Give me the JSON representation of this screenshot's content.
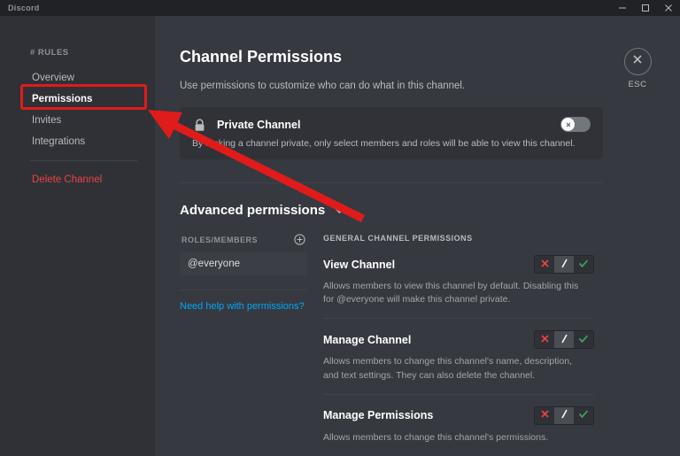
{
  "window": {
    "title": "Discord",
    "controls": [
      {
        "name": "minimize",
        "glyph": "minimize-icon"
      },
      {
        "name": "maximize",
        "glyph": "maximize-icon"
      },
      {
        "name": "close",
        "glyph": "close-icon"
      }
    ]
  },
  "sidebar": {
    "header": "# RULES",
    "items": [
      {
        "label": "Overview",
        "active": false
      },
      {
        "label": "Permissions",
        "active": true
      },
      {
        "label": "Invites",
        "active": false
      },
      {
        "label": "Integrations",
        "active": false
      }
    ],
    "danger_item": "Delete Channel"
  },
  "header": {
    "title": "Channel Permissions",
    "subtitle": "Use permissions to customize who can do what in this channel."
  },
  "esc": {
    "label": "ESC",
    "icon": "close-icon"
  },
  "private_channel": {
    "icon": "lock-icon",
    "title": "Private Channel",
    "description": "By making a channel private, only select members and roles will be able to view this channel.",
    "toggle_state": "off",
    "toggle_icon": "x-icon"
  },
  "advanced": {
    "title": "Advanced permissions",
    "chevron": "chevron-down-icon"
  },
  "roles": {
    "header": "ROLES/MEMBERS",
    "add_icon": "plus-circle-icon",
    "items": [
      {
        "label": "@everyone",
        "selected": true
      }
    ],
    "help_link": "Need help with permissions?"
  },
  "permissions": {
    "header": "GENERAL CHANNEL PERMISSIONS",
    "states": {
      "deny": "x-icon",
      "neutral": "slash-icon",
      "allow": "check-icon"
    },
    "items": [
      {
        "name": "View Channel",
        "description": "Allows members to view this channel by default. Disabling this for @everyone will make this channel private.",
        "state": "neutral"
      },
      {
        "name": "Manage Channel",
        "description": "Allows members to change this channel's name, description, and text settings. They can also delete the channel.",
        "state": "neutral"
      },
      {
        "name": "Manage Permissions",
        "description": "Allows members to change this channel's permissions.",
        "state": "neutral"
      }
    ]
  },
  "annotation": {
    "highlight_target": "Permissions",
    "arrow_color": "#e01b1b"
  },
  "colors": {
    "sidebar_bg": "#2f3136",
    "main_bg": "#36393f",
    "titlebar_bg": "#202225",
    "accent_link": "#00a8fc",
    "danger": "#ed4245",
    "allow": "#3ba55d",
    "annotation": "#e01b1b"
  }
}
